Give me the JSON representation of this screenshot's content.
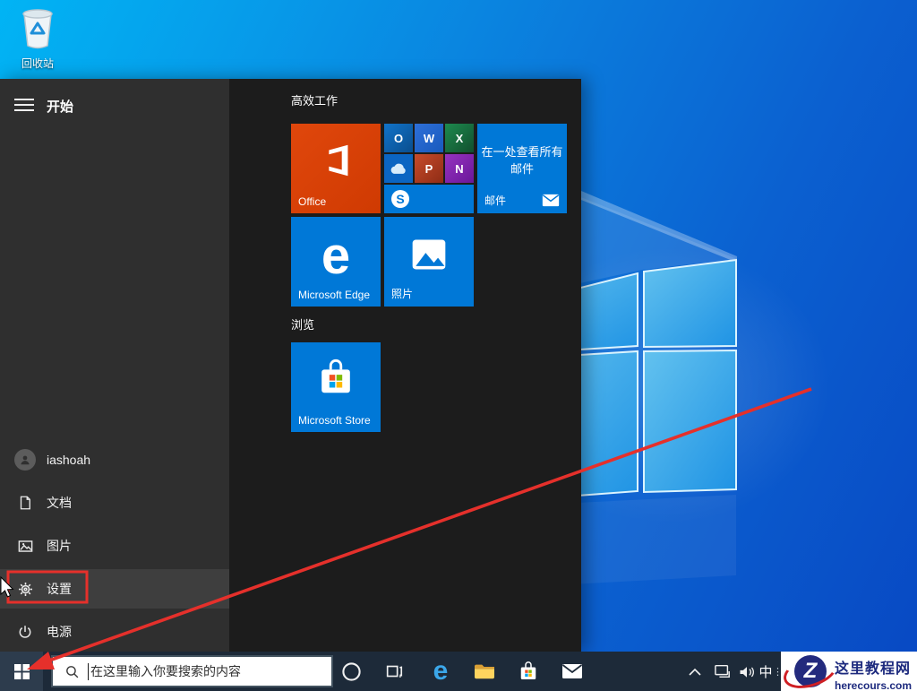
{
  "desktop": {
    "recycle_bin_label": "回收站"
  },
  "start_menu": {
    "header": "开始",
    "sections": [
      {
        "title": "高效工作"
      },
      {
        "title": "浏览"
      }
    ],
    "tiles": {
      "office": {
        "label": "Office"
      },
      "office_group": {
        "apps": [
          {
            "name": "Outlook",
            "letter": "O"
          },
          {
            "name": "Word",
            "letter": "W"
          },
          {
            "name": "Excel",
            "letter": "X"
          },
          {
            "name": "OneDrive"
          },
          {
            "name": "PowerPoint",
            "letter": "P"
          },
          {
            "name": "OneNote",
            "letter": "N"
          },
          {
            "name": "Skype",
            "letter": "S"
          }
        ]
      },
      "mail": {
        "body_line1": "在一处查看所有",
        "body_line2": "邮件",
        "label": "邮件"
      },
      "edge": {
        "glyph": "e",
        "label": "Microsoft Edge"
      },
      "photos": {
        "label": "照片"
      },
      "store": {
        "label": "Microsoft Store"
      }
    },
    "sidebar": [
      {
        "label": "iashoah"
      },
      {
        "label": "文档"
      },
      {
        "label": "图片"
      },
      {
        "label": "设置"
      },
      {
        "label": "电源"
      }
    ]
  },
  "taskbar": {
    "search_placeholder": "在这里输入你要搜索的内容",
    "ime": "中"
  },
  "watermark": {
    "logo_letter": "Z",
    "site_name": "这里教程网",
    "site_url": "herecours.com"
  },
  "colors": {
    "accent_blue": "#0078d7",
    "office_orange": "#d83b01",
    "annotation_red": "#e5302b",
    "taskbar": "#1d2a39",
    "menu_sidebar": "#2f2f2f",
    "menu_tiles_bg": "#1c1c1c",
    "watermark_navy": "#1d2a7e",
    "desktop_top_left": "#01b4f4",
    "desktop_bottom_right": "#0848c3"
  }
}
